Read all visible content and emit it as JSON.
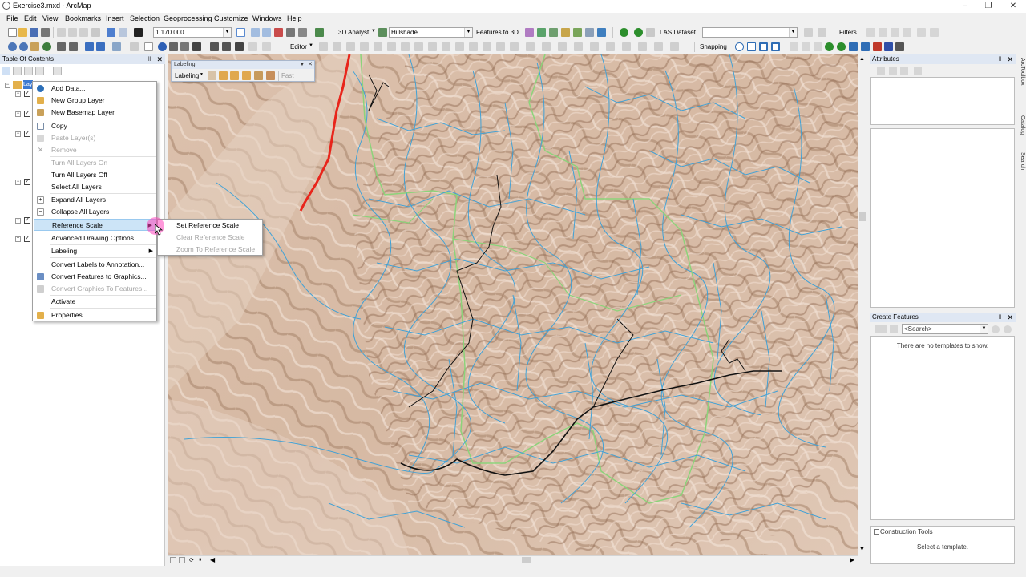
{
  "window": {
    "title": "Exercise3.mxd - ArcMap",
    "minimize": "–",
    "maximize": "❐",
    "close": "✕"
  },
  "menubar": [
    "File",
    "Edit",
    "View",
    "Bookmarks",
    "Insert",
    "Selection",
    "Geoprocessing",
    "Customize",
    "Windows",
    "Help"
  ],
  "toolbar": {
    "scale_value": "1:170 000",
    "analyst_label": "3D Analyst",
    "layer_value": "Hillshade",
    "features_to_3d": "Features to 3D...",
    "las_label": "LAS Dataset",
    "filters_label": "Filters",
    "editor_label": "Editor",
    "snapping_label": "Snapping"
  },
  "labeling_toolbar": {
    "title": "Labeling",
    "menu_label": "Labeling",
    "fast_label": "Fast"
  },
  "toc": {
    "title": "Table Of Contents",
    "root_label": "Layers"
  },
  "context_menu": {
    "items": [
      {
        "label": "Add Data...",
        "enabled": true,
        "icon": "add-data-icon"
      },
      {
        "label": "New Group Layer",
        "enabled": true,
        "icon": "group-layer-icon"
      },
      {
        "label": "New Basemap Layer",
        "enabled": true,
        "icon": "basemap-icon"
      },
      {
        "label": "Copy",
        "enabled": true,
        "icon": "copy-icon"
      },
      {
        "label": "Paste Layer(s)",
        "enabled": false,
        "icon": "paste-icon"
      },
      {
        "label": "Remove",
        "enabled": false,
        "icon": "remove-icon"
      },
      {
        "label": "Turn All Layers On",
        "enabled": false,
        "icon": ""
      },
      {
        "label": "Turn All Layers Off",
        "enabled": true,
        "icon": ""
      },
      {
        "label": "Select All Layers",
        "enabled": true,
        "icon": ""
      },
      {
        "label": "Expand All Layers",
        "enabled": true,
        "icon": "expand-icon"
      },
      {
        "label": "Collapse All Layers",
        "enabled": true,
        "icon": "collapse-icon"
      },
      {
        "label": "Reference Scale",
        "enabled": true,
        "icon": "",
        "submenu": true
      },
      {
        "label": "Advanced Drawing Options...",
        "enabled": true,
        "icon": ""
      },
      {
        "label": "Labeling",
        "enabled": true,
        "icon": "",
        "submenu": true
      },
      {
        "label": "Convert Labels to Annotation...",
        "enabled": true,
        "icon": ""
      },
      {
        "label": "Convert Features to Graphics...",
        "enabled": true,
        "icon": "convert-graphics-icon"
      },
      {
        "label": "Convert Graphics To Features...",
        "enabled": false,
        "icon": "convert-features-icon"
      },
      {
        "label": "Activate",
        "enabled": true,
        "icon": ""
      },
      {
        "label": "Properties...",
        "enabled": true,
        "icon": "properties-icon"
      }
    ]
  },
  "submenu": {
    "items": [
      {
        "label": "Set Reference Scale",
        "enabled": true
      },
      {
        "label": "Clear Reference Scale",
        "enabled": false
      },
      {
        "label": "Zoom To Reference Scale",
        "enabled": false
      }
    ]
  },
  "attributes": {
    "title": "Attributes"
  },
  "create_features": {
    "title": "Create Features",
    "search_placeholder": "<Search>",
    "empty_message": "There are no templates to show.",
    "construction_title": "Construction Tools",
    "construction_message": "Select a template."
  },
  "side_tabs": [
    "ArcToolbox",
    "Catalog",
    "Search"
  ],
  "colors": {
    "menu_highlight": "#cce4f7",
    "pane_header": "#dfe7f3",
    "hillshade": "#c9a88f",
    "streams": "#3aa0d8",
    "boundary": "#8cd37a",
    "road": "#e8251b"
  }
}
